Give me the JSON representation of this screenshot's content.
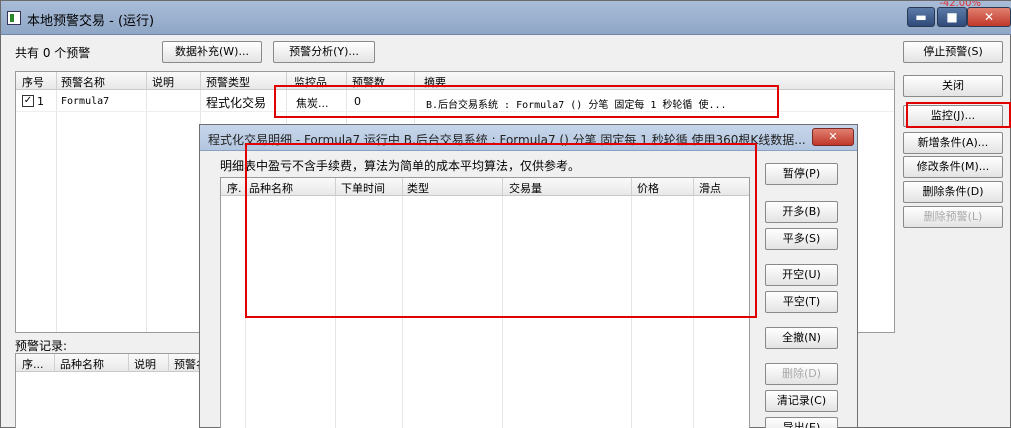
{
  "window": {
    "title": "本地预警交易 - (运行)",
    "top_strip": "-42.00%"
  },
  "toolbar": {
    "alert_count": "共有 0 个预警",
    "data_supplement": "数据补充(W)...",
    "alert_analysis": "预警分析(Y)..."
  },
  "alert_table": {
    "headers": [
      "序号",
      "预警名称",
      "说明",
      "预警类型",
      "监控品",
      "预警数",
      "摘要"
    ],
    "rows": [
      {
        "checked": true,
        "check_mark": "✓",
        "index": "1",
        "name": "Formula7",
        "desc": "",
        "type": "程式化交易",
        "monitor": "焦炭...",
        "count": "0",
        "summary": "B.后台交易系统 : Formula7 () 分笔 固定每 1 秒轮循 使..."
      }
    ]
  },
  "right_buttons": {
    "stop": "停止预警(S)",
    "close": "关闭",
    "monitor": "监控(J)...",
    "add_condition": "新增条件(A)...",
    "edit_condition": "修改条件(M)...",
    "delete_condition": "删除条件(D)",
    "delete_alert": "删除预警(L)"
  },
  "log": {
    "label": "预警记录:",
    "headers": [
      "序...",
      "品种名称",
      "说明",
      "预警名"
    ]
  },
  "dialog": {
    "title": "程式化交易明细 - Formula7 运行中  B.后台交易系统 : Formula7 () 分笔 固定每 1 秒轮循 使用360根K线数据...",
    "close_icon": "✕",
    "note": "明细表中盈亏不含手续费，算法为简单的成本平均算法，仅供参考。",
    "headers": [
      "序.",
      "品种名称",
      "下单时间",
      "类型",
      "交易量",
      "价格",
      "滑点"
    ],
    "buttons": {
      "pause": "暂停(P)",
      "open_long": "开多(B)",
      "close_long": "平多(S)",
      "open_short": "开空(U)",
      "close_short": "平空(T)",
      "cancel_all": "全撤(N)",
      "delete": "删除(D)",
      "clear": "清记录(C)",
      "export": "导出(E)"
    }
  }
}
